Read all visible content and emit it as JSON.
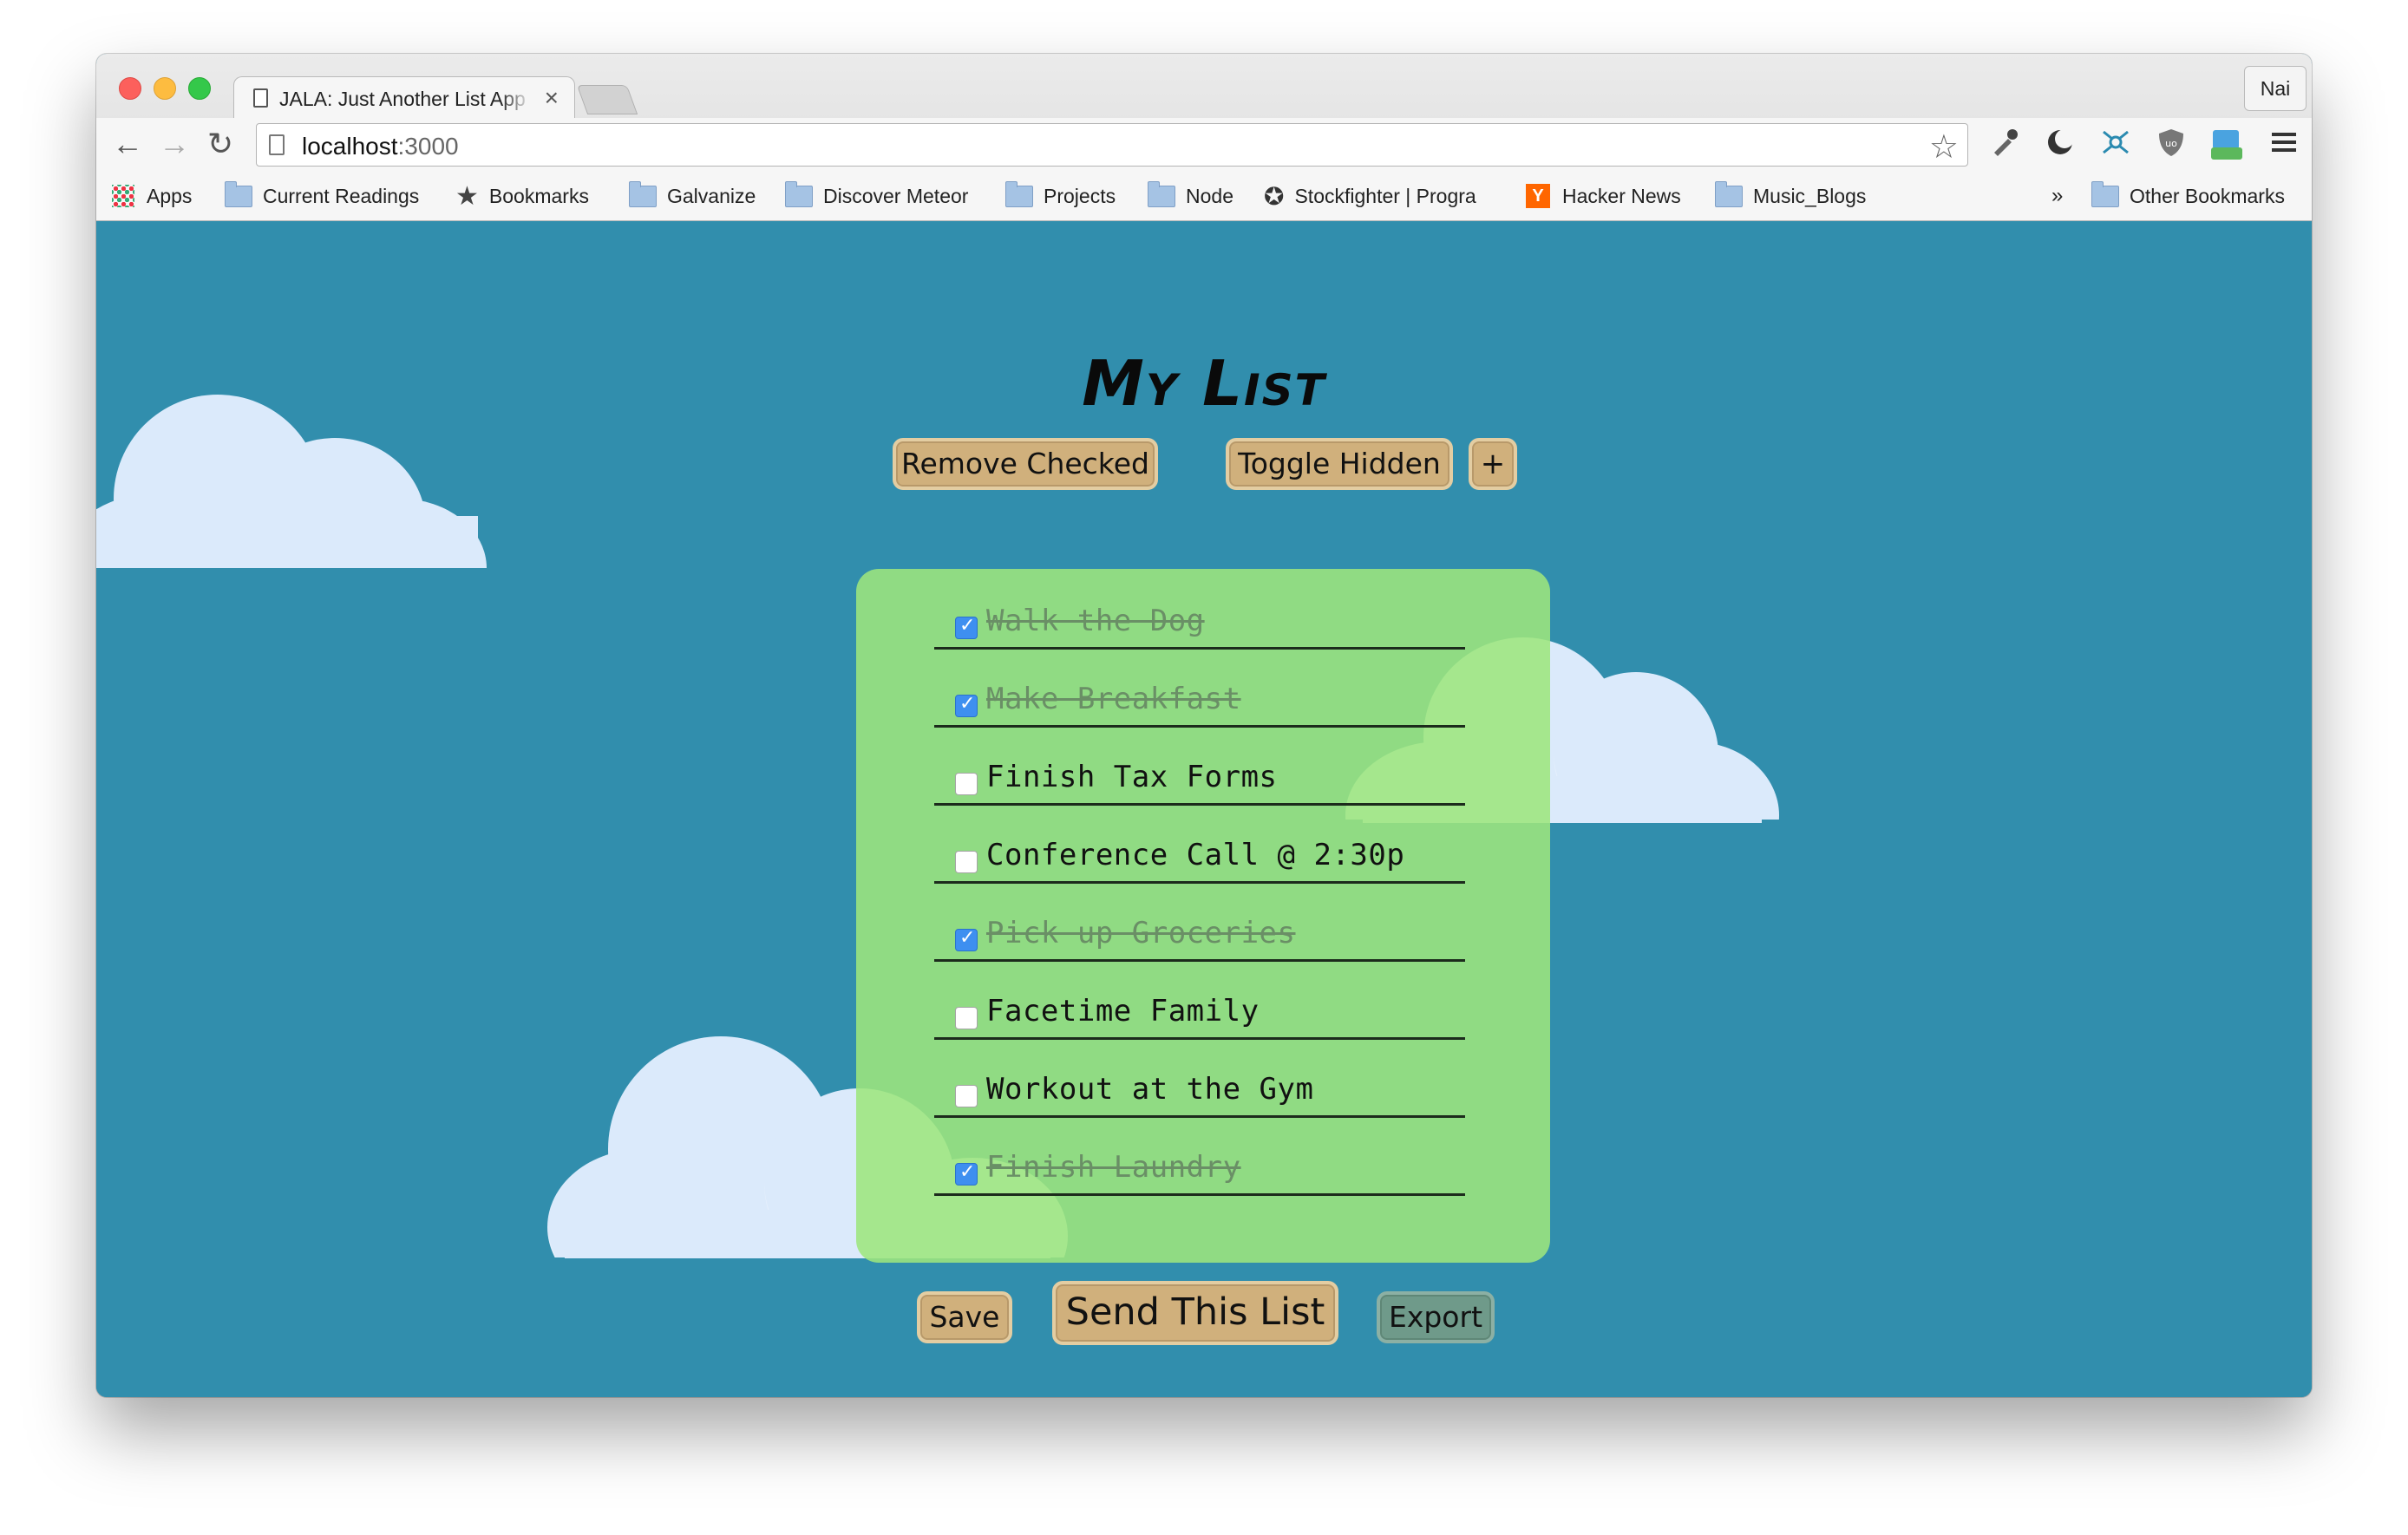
{
  "browser": {
    "tab_title": "JALA: Just Another List App",
    "tab_close": "×",
    "profile": "Nai",
    "url_host": "localhost",
    "url_port": ":3000",
    "nav": {
      "back": "←",
      "forward": "→",
      "reload": "↻"
    },
    "star": "☆",
    "extensions": [
      "eyedropper-icon",
      "moon-icon",
      "network-icon",
      "ublock-shield-icon",
      "beta-extension-icon",
      "menu-icon"
    ],
    "bookmarks": [
      {
        "label": "Apps",
        "icon": "apps-grid-icon"
      },
      {
        "label": "Current Readings",
        "icon": "folder-icon"
      },
      {
        "label": "Bookmarks",
        "icon": "star-icon"
      },
      {
        "label": "Galvanize",
        "icon": "folder-icon"
      },
      {
        "label": "Discover Meteor",
        "icon": "folder-icon"
      },
      {
        "label": "Projects",
        "icon": "folder-icon"
      },
      {
        "label": "Node",
        "icon": "folder-icon"
      },
      {
        "label": "Stockfighter | Progra",
        "icon": "gear-icon"
      },
      {
        "label": "Hacker News",
        "icon": "hacker-news-icon"
      },
      {
        "label": "Music_Blogs",
        "icon": "folder-icon"
      }
    ],
    "overflow": "»",
    "other_bookmarks": "Other Bookmarks"
  },
  "app": {
    "title": "My List",
    "buttons": {
      "remove_checked": "Remove Checked",
      "toggle_hidden": "Toggle Hidden",
      "add": "+",
      "save": "Save",
      "send": "Send This List",
      "export": "Export"
    },
    "items": [
      {
        "text": "Walk the Dog",
        "checked": true
      },
      {
        "text": "Make Breakfast",
        "checked": true
      },
      {
        "text": "Finish Tax Forms",
        "checked": false
      },
      {
        "text": "Conference Call @ 2:30p",
        "checked": false
      },
      {
        "text": "Pick up Groceries",
        "checked": true
      },
      {
        "text": "Facetime Family",
        "checked": false
      },
      {
        "text": "Workout at the Gym",
        "checked": false
      },
      {
        "text": "Finish Laundry",
        "checked": true
      }
    ]
  },
  "colors": {
    "page_bg": "#318ead",
    "card_bg": "#9de67d",
    "button_bg": "#d0b07c",
    "checkbox_on": "#3e8ff0"
  }
}
